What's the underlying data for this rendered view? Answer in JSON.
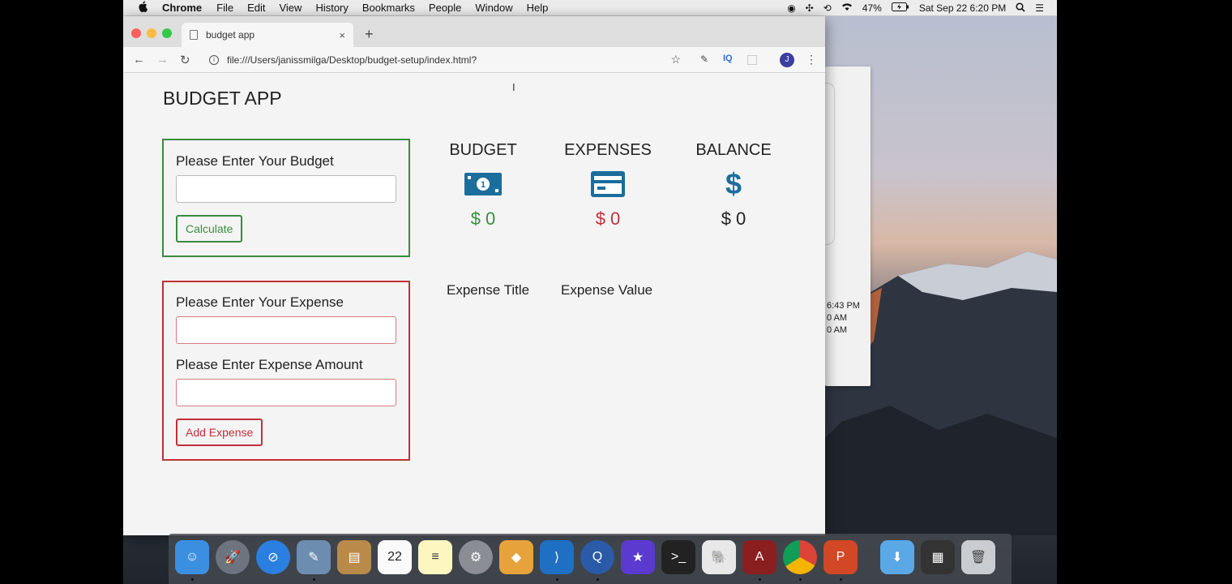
{
  "menubar": {
    "app_name": "Chrome",
    "items": [
      "File",
      "Edit",
      "View",
      "History",
      "Bookmarks",
      "People",
      "Window",
      "Help"
    ],
    "battery": "47%",
    "clock": "Sat Sep 22  6:20 PM"
  },
  "background_window": {
    "times": [
      "6:43 PM",
      "0 AM",
      "0 AM"
    ]
  },
  "browser": {
    "tab_title": "budget app",
    "tab_close": "×",
    "new_tab": "+",
    "url": "file:///Users/janissmilga/Desktop/budget-setup/index.html?",
    "extension_iq": "IQ",
    "avatar_letter": "J"
  },
  "app": {
    "title": "BUDGET APP",
    "budget_form": {
      "label": "Please Enter Your Budget",
      "value": "",
      "button": "Calculate"
    },
    "expense_form": {
      "title_label": "Please Enter Your Expense",
      "title_value": "",
      "amount_label": "Please Enter Expense Amount",
      "amount_value": "",
      "button": "Add Expense"
    },
    "stats": {
      "budget": {
        "title": "BUDGET",
        "value": "$ 0",
        "icon": "money-bill-icon"
      },
      "expenses": {
        "title": "EXPENSES",
        "value": "$ 0",
        "icon": "credit-card-icon"
      },
      "balance": {
        "title": "BALANCE",
        "value": "$ 0",
        "icon": "dollar-sign-icon"
      }
    },
    "expense_list": {
      "headers": [
        "Expense Title",
        "Expense Value"
      ]
    },
    "colors": {
      "green": "#3a8c3e",
      "red": "#c0303a",
      "blue": "#1b6e9c"
    }
  },
  "dock": {
    "calendar_day": "22"
  }
}
